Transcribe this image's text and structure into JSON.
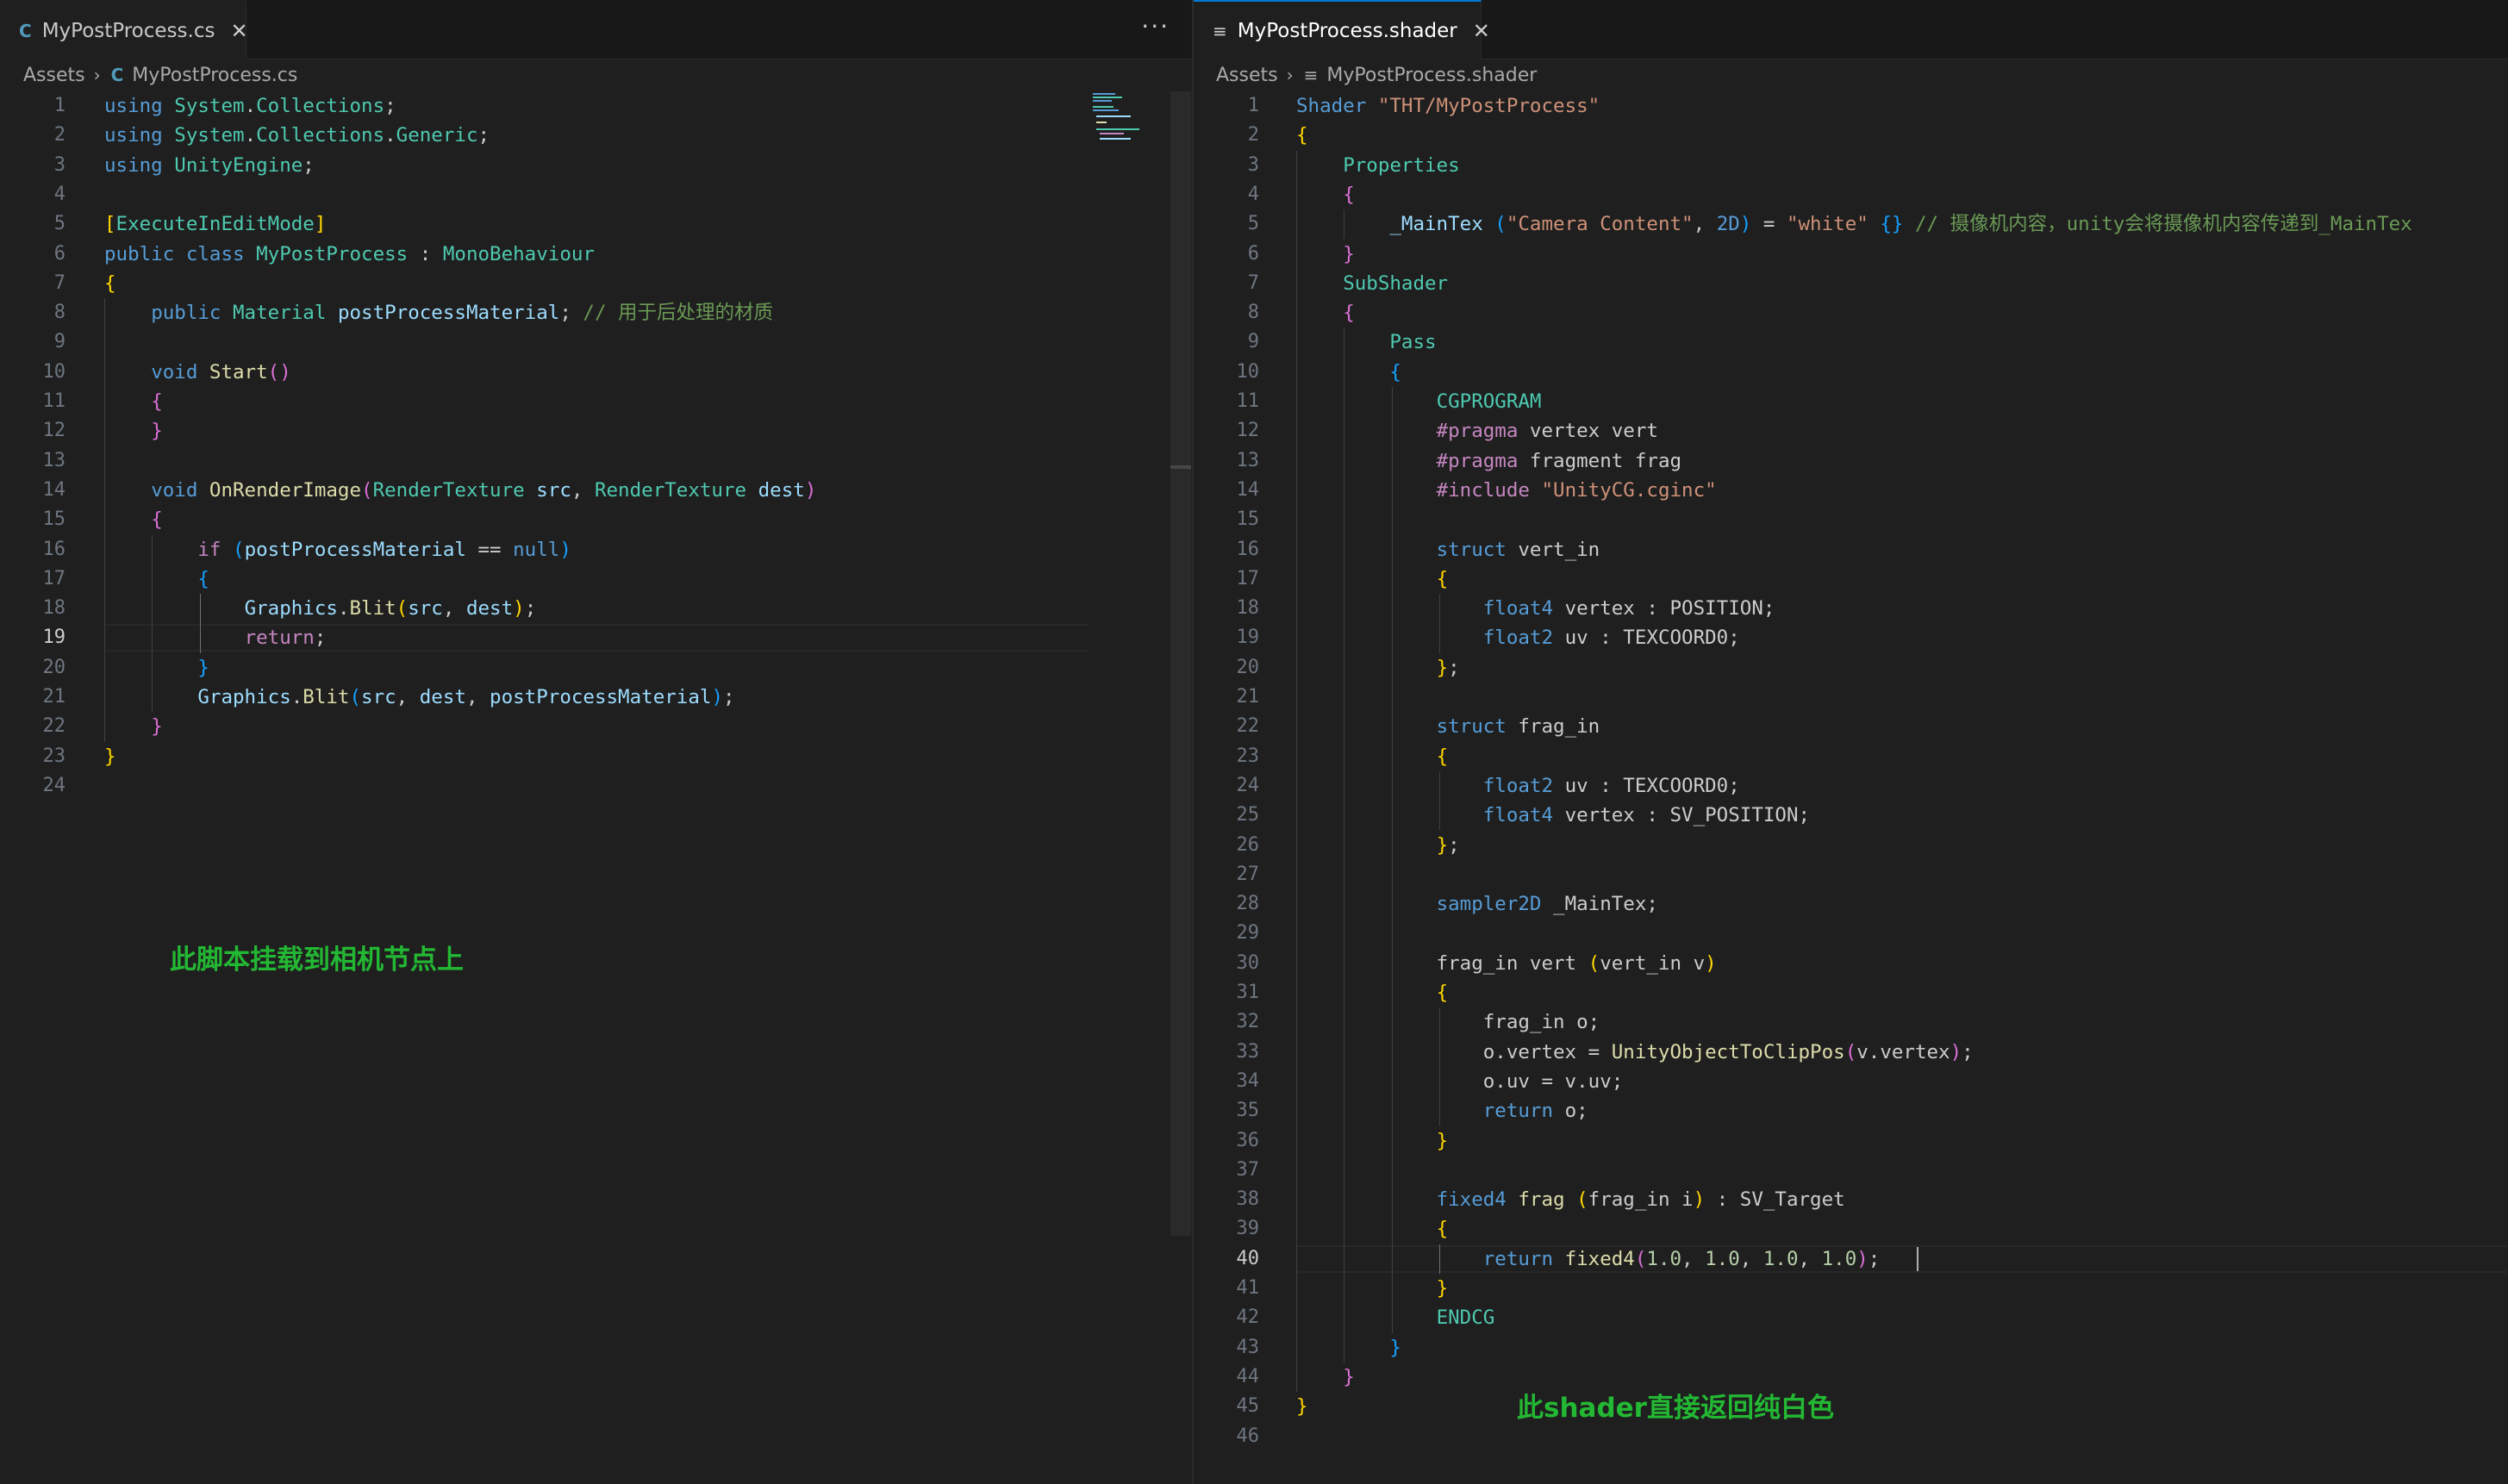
{
  "left": {
    "tab": {
      "icon": "C",
      "label": "MyPostProcess.cs",
      "close": "✕"
    },
    "more": "···",
    "breadcrumb": {
      "root": "Assets",
      "icon": "C",
      "file": "MyPostProcess.cs"
    },
    "current_line": 19,
    "line_numbers": [
      "1",
      "2",
      "3",
      "4",
      "5",
      "6",
      "7",
      "8",
      "9",
      "10",
      "11",
      "12",
      "13",
      "14",
      "15",
      "16",
      "17",
      "18",
      "19",
      "20",
      "21",
      "22",
      "23",
      "24"
    ],
    "code": [
      [
        [
          "kw",
          "using"
        ],
        [
          "p",
          " "
        ],
        [
          "ty",
          "System"
        ],
        [
          "p",
          "."
        ],
        [
          "ty",
          "Collections"
        ],
        [
          "p",
          ";"
        ]
      ],
      [
        [
          "kw",
          "using"
        ],
        [
          "p",
          " "
        ],
        [
          "ty",
          "System"
        ],
        [
          "p",
          "."
        ],
        [
          "ty",
          "Collections"
        ],
        [
          "p",
          "."
        ],
        [
          "ty",
          "Generic"
        ],
        [
          "p",
          ";"
        ]
      ],
      [
        [
          "kw",
          "using"
        ],
        [
          "p",
          " "
        ],
        [
          "ty",
          "UnityEngine"
        ],
        [
          "p",
          ";"
        ]
      ],
      [],
      [
        [
          "b1",
          "["
        ],
        [
          "ty",
          "ExecuteInEditMode"
        ],
        [
          "b1",
          "]"
        ]
      ],
      [
        [
          "kw",
          "public"
        ],
        [
          "p",
          " "
        ],
        [
          "kw",
          "class"
        ],
        [
          "p",
          " "
        ],
        [
          "ty",
          "MyPostProcess"
        ],
        [
          "p",
          " : "
        ],
        [
          "ty",
          "MonoBehaviour"
        ]
      ],
      [
        [
          "b1",
          "{"
        ]
      ],
      [
        [
          "p",
          "    "
        ],
        [
          "kw",
          "public"
        ],
        [
          "p",
          " "
        ],
        [
          "ty",
          "Material"
        ],
        [
          "p",
          " "
        ],
        [
          "va",
          "postProcessMaterial"
        ],
        [
          "p",
          "; "
        ],
        [
          "cm",
          "// 用于后处理的材质"
        ]
      ],
      [],
      [
        [
          "p",
          "    "
        ],
        [
          "kw",
          "void"
        ],
        [
          "p",
          " "
        ],
        [
          "fn",
          "Start"
        ],
        [
          "b2",
          "()"
        ]
      ],
      [
        [
          "p",
          "    "
        ],
        [
          "b2",
          "{"
        ]
      ],
      [
        [
          "p",
          "    "
        ],
        [
          "b2",
          "}"
        ]
      ],
      [],
      [
        [
          "p",
          "    "
        ],
        [
          "kw",
          "void"
        ],
        [
          "p",
          " "
        ],
        [
          "fn",
          "OnRenderImage"
        ],
        [
          "b2",
          "("
        ],
        [
          "ty",
          "RenderTexture"
        ],
        [
          "p",
          " "
        ],
        [
          "va",
          "src"
        ],
        [
          "p",
          ", "
        ],
        [
          "ty",
          "RenderTexture"
        ],
        [
          "p",
          " "
        ],
        [
          "va",
          "dest"
        ],
        [
          "b2",
          ")"
        ]
      ],
      [
        [
          "p",
          "    "
        ],
        [
          "b2",
          "{"
        ]
      ],
      [
        [
          "p",
          "        "
        ],
        [
          "kw2",
          "if"
        ],
        [
          "p",
          " "
        ],
        [
          "b3",
          "("
        ],
        [
          "va",
          "postProcessMaterial"
        ],
        [
          "p",
          " == "
        ],
        [
          "kw",
          "null"
        ],
        [
          "b3",
          ")"
        ]
      ],
      [
        [
          "p",
          "        "
        ],
        [
          "b3",
          "{"
        ]
      ],
      [
        [
          "p",
          "            "
        ],
        [
          "va",
          "Graphics"
        ],
        [
          "p",
          "."
        ],
        [
          "fn",
          "Blit"
        ],
        [
          "b1",
          "("
        ],
        [
          "va",
          "src"
        ],
        [
          "p",
          ", "
        ],
        [
          "va",
          "dest"
        ],
        [
          "b1",
          ")"
        ],
        [
          "p",
          ";"
        ]
      ],
      [
        [
          "p",
          "            "
        ],
        [
          "kw2",
          "return"
        ],
        [
          "p",
          ";"
        ]
      ],
      [
        [
          "p",
          "        "
        ],
        [
          "b3",
          "}"
        ]
      ],
      [
        [
          "p",
          "        "
        ],
        [
          "va",
          "Graphics"
        ],
        [
          "p",
          "."
        ],
        [
          "fn",
          "Blit"
        ],
        [
          "b3",
          "("
        ],
        [
          "va",
          "src"
        ],
        [
          "p",
          ", "
        ],
        [
          "va",
          "dest"
        ],
        [
          "p",
          ", "
        ],
        [
          "va",
          "postProcessMaterial"
        ],
        [
          "b3",
          ")"
        ],
        [
          "p",
          ";"
        ]
      ],
      [
        [
          "p",
          "    "
        ],
        [
          "b2",
          "}"
        ]
      ],
      [
        [
          "b1",
          "}"
        ]
      ],
      []
    ],
    "annotation": "此脚本挂载到相机节点上"
  },
  "right": {
    "tab": {
      "icon": "≡",
      "label": "MyPostProcess.shader",
      "close": "✕"
    },
    "breadcrumb": {
      "root": "Assets",
      "icon": "≡",
      "file": "MyPostProcess.shader"
    },
    "current_line": 40,
    "line_numbers": [
      "1",
      "2",
      "3",
      "4",
      "5",
      "6",
      "7",
      "8",
      "9",
      "10",
      "11",
      "12",
      "13",
      "14",
      "15",
      "16",
      "17",
      "18",
      "19",
      "20",
      "21",
      "22",
      "23",
      "24",
      "25",
      "26",
      "27",
      "28",
      "29",
      "30",
      "31",
      "32",
      "33",
      "34",
      "35",
      "36",
      "37",
      "38",
      "39",
      "40",
      "41",
      "42",
      "43",
      "44",
      "45",
      "46"
    ],
    "code": [
      [
        [
          "kw",
          "Shader"
        ],
        [
          "p",
          " "
        ],
        [
          "st",
          "\"THT/MyPostProcess\""
        ]
      ],
      [
        [
          "b1",
          "{"
        ]
      ],
      [
        [
          "p",
          "    "
        ],
        [
          "ty",
          "Properties"
        ]
      ],
      [
        [
          "p",
          "    "
        ],
        [
          "b2",
          "{"
        ]
      ],
      [
        [
          "p",
          "        "
        ],
        [
          "va",
          "_MainTex"
        ],
        [
          "p",
          " "
        ],
        [
          "b3",
          "("
        ],
        [
          "st",
          "\"Camera Content\""
        ],
        [
          "p",
          ", "
        ],
        [
          "kw",
          "2D"
        ],
        [
          "b3",
          ")"
        ],
        [
          "p",
          " = "
        ],
        [
          "st",
          "\"white\""
        ],
        [
          "p",
          " "
        ],
        [
          "b3",
          "{}"
        ],
        [
          "p",
          " "
        ],
        [
          "cm",
          "// 摄像机内容，unity会将摄像机内容传递到_MainTex"
        ]
      ],
      [
        [
          "p",
          "    "
        ],
        [
          "b2",
          "}"
        ]
      ],
      [
        [
          "p",
          "    "
        ],
        [
          "ty",
          "SubShader"
        ]
      ],
      [
        [
          "p",
          "    "
        ],
        [
          "b2",
          "{"
        ]
      ],
      [
        [
          "p",
          "        "
        ],
        [
          "ty",
          "Pass"
        ]
      ],
      [
        [
          "p",
          "        "
        ],
        [
          "b3",
          "{"
        ]
      ],
      [
        [
          "p",
          "            "
        ],
        [
          "ty",
          "CGPROGRAM"
        ]
      ],
      [
        [
          "p",
          "            "
        ],
        [
          "kw2",
          "#pragma"
        ],
        [
          "p",
          " vertex vert"
        ]
      ],
      [
        [
          "p",
          "            "
        ],
        [
          "kw2",
          "#pragma"
        ],
        [
          "p",
          " fragment frag"
        ]
      ],
      [
        [
          "p",
          "            "
        ],
        [
          "kw2",
          "#include"
        ],
        [
          "p",
          " "
        ],
        [
          "st",
          "\"UnityCG.cginc\""
        ]
      ],
      [],
      [
        [
          "p",
          "            "
        ],
        [
          "kw",
          "struct"
        ],
        [
          "p",
          " vert_in"
        ]
      ],
      [
        [
          "p",
          "            "
        ],
        [
          "b1",
          "{"
        ]
      ],
      [
        [
          "p",
          "                "
        ],
        [
          "kw",
          "float4"
        ],
        [
          "p",
          " vertex : POSITION;"
        ]
      ],
      [
        [
          "p",
          "                "
        ],
        [
          "kw",
          "float2"
        ],
        [
          "p",
          " uv : TEXCOORD0;"
        ]
      ],
      [
        [
          "p",
          "            "
        ],
        [
          "b1",
          "}"
        ],
        [
          "p",
          ";"
        ]
      ],
      [],
      [
        [
          "p",
          "            "
        ],
        [
          "kw",
          "struct"
        ],
        [
          "p",
          " frag_in"
        ]
      ],
      [
        [
          "p",
          "            "
        ],
        [
          "b1",
          "{"
        ]
      ],
      [
        [
          "p",
          "                "
        ],
        [
          "kw",
          "float2"
        ],
        [
          "p",
          " uv : TEXCOORD0;"
        ]
      ],
      [
        [
          "p",
          "                "
        ],
        [
          "kw",
          "float4"
        ],
        [
          "p",
          " vertex : SV_POSITION;"
        ]
      ],
      [
        [
          "p",
          "            "
        ],
        [
          "b1",
          "}"
        ],
        [
          "p",
          ";"
        ]
      ],
      [],
      [
        [
          "p",
          "            "
        ],
        [
          "kw",
          "sampler2D"
        ],
        [
          "p",
          " _MainTex;"
        ]
      ],
      [],
      [
        [
          "p",
          "            frag_in vert "
        ],
        [
          "b1",
          "("
        ],
        [
          "p",
          "vert_in v"
        ],
        [
          "b1",
          ")"
        ]
      ],
      [
        [
          "p",
          "            "
        ],
        [
          "b1",
          "{"
        ]
      ],
      [
        [
          "p",
          "                frag_in o;"
        ]
      ],
      [
        [
          "p",
          "                o.vertex = "
        ],
        [
          "fn",
          "UnityObjectToClipPos"
        ],
        [
          "b2",
          "("
        ],
        [
          "p",
          "v.vertex"
        ],
        [
          "b2",
          ")"
        ],
        [
          "p",
          ";"
        ]
      ],
      [
        [
          "p",
          "                o.uv = v.uv;"
        ]
      ],
      [
        [
          "p",
          "                "
        ],
        [
          "kw",
          "return"
        ],
        [
          "p",
          " o;"
        ]
      ],
      [
        [
          "p",
          "            "
        ],
        [
          "b1",
          "}"
        ]
      ],
      [],
      [
        [
          "p",
          "            "
        ],
        [
          "kw",
          "fixed4"
        ],
        [
          "p",
          " "
        ],
        [
          "fn",
          "frag"
        ],
        [
          "p",
          " "
        ],
        [
          "b1",
          "("
        ],
        [
          "p",
          "frag_in i"
        ],
        [
          "b1",
          ")"
        ],
        [
          "p",
          " : SV_Target"
        ]
      ],
      [
        [
          "p",
          "            "
        ],
        [
          "b1",
          "{"
        ]
      ],
      [
        [
          "p",
          "                "
        ],
        [
          "kw",
          "return"
        ],
        [
          "p",
          " "
        ],
        [
          "fn",
          "fixed4"
        ],
        [
          "b2",
          "("
        ],
        [
          "nu",
          "1.0"
        ],
        [
          "p",
          ", "
        ],
        [
          "nu",
          "1.0"
        ],
        [
          "p",
          ", "
        ],
        [
          "nu",
          "1.0"
        ],
        [
          "p",
          ", "
        ],
        [
          "nu",
          "1.0"
        ],
        [
          "b2",
          ")"
        ],
        [
          "p",
          ";"
        ]
      ],
      [
        [
          "p",
          "            "
        ],
        [
          "b1",
          "}"
        ]
      ],
      [
        [
          "p",
          "            "
        ],
        [
          "ty",
          "ENDCG"
        ]
      ],
      [
        [
          "p",
          "        "
        ],
        [
          "b3",
          "}"
        ]
      ],
      [
        [
          "p",
          "    "
        ],
        [
          "b2",
          "}"
        ]
      ],
      [
        [
          "b1",
          "}"
        ]
      ],
      []
    ],
    "annotation": "此shader直接返回纯白色"
  }
}
